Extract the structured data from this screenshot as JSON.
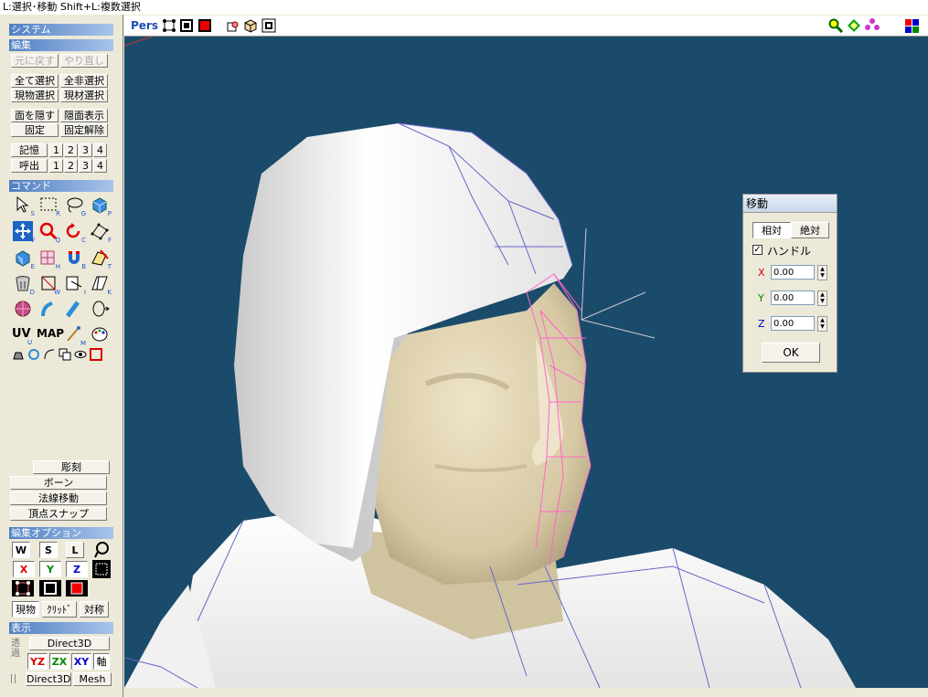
{
  "status": {
    "text": "L:選択･移動  Shift+L:複数選択"
  },
  "sections": {
    "system": "システム",
    "edit": "編集",
    "command": "コマンド",
    "edit_option": "編集オプション",
    "display": "表示"
  },
  "edit": {
    "undo": "元に戻す",
    "redo": "やり直し",
    "select_all": "全て選択",
    "deselect_all": "全非選択",
    "select_current_obj": "現物選択",
    "select_current_mat": "現材選択",
    "hide_face": "面を隠す",
    "show_hidden": "隠面表示",
    "fix": "固定",
    "unfix": "固定解除",
    "memory": "記憶",
    "recall": "呼出",
    "slots": [
      "1",
      "2",
      "3",
      "4"
    ]
  },
  "commands": {
    "sculpt": "彫刻",
    "bone": "ボーン",
    "normal_move": "法線移動",
    "vertex_snap": "頂点スナップ",
    "uv_label": "UV",
    "map_label": "MAP",
    "subs": [
      "S",
      "R",
      "G",
      "P",
      "V",
      "Q",
      "C",
      "F",
      "E",
      "H",
      "B",
      "T",
      "D",
      "W",
      "I",
      "K",
      "U",
      "M"
    ]
  },
  "edit_option": {
    "w": "W",
    "s": "S",
    "l": "L",
    "x": "X",
    "y": "Y",
    "z": "Z",
    "current_obj": "現物",
    "grid": "ｸﾘｯﾄﾞ",
    "symmetry": "対称"
  },
  "display": {
    "renderer": "Direct3D",
    "transparent": "透過",
    "yz": "YZ",
    "zx": "ZX",
    "xy": "XY",
    "axis": "軸",
    "bottom_renderer": "Direct3D",
    "mesh": "Mesh"
  },
  "viewport": {
    "mode": "Pers"
  },
  "move_dialog": {
    "title": "移動",
    "tab_relative": "相対",
    "tab_absolute": "絶対",
    "handle_label": "ハンドル",
    "handle_checked": true,
    "axes": [
      {
        "label": "X",
        "value": "0.00",
        "color": "#cc0000"
      },
      {
        "label": "Y",
        "value": "0.00",
        "color": "#008800"
      },
      {
        "label": "Z",
        "value": "0.00",
        "color": "#0000cc"
      }
    ],
    "ok": "OK"
  },
  "colors": {
    "viewport_bg": "#1b4b6a",
    "panel_header": "#4f7fc3",
    "wire": "#6666cc",
    "selected_wire": "#ff66cc"
  }
}
